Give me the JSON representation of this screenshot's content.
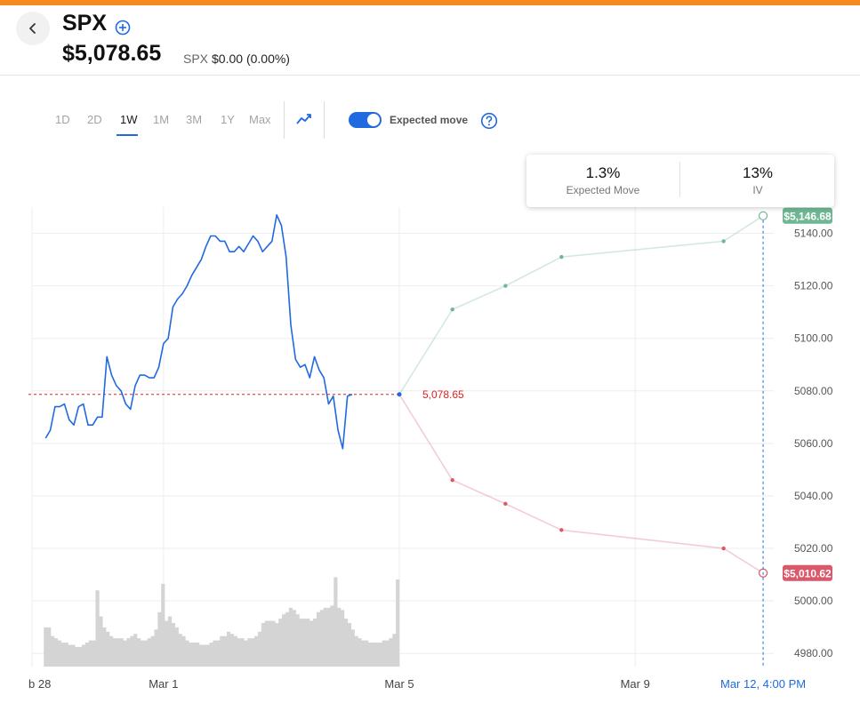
{
  "header": {
    "symbol": "SPX",
    "price": "$5,078.65",
    "sub_symbol": "SPX",
    "change": "$0.00 (0.00%)"
  },
  "ranges": [
    "1D",
    "2D",
    "1W",
    "1M",
    "3M",
    "1Y",
    "Max"
  ],
  "active_range": "1W",
  "toggle": {
    "label": "Expected move",
    "on": true
  },
  "icons": {
    "back": "chevron-left-icon",
    "add": "plus-circle-icon",
    "chart_type": "trend-line-icon",
    "help": "question-circle-icon"
  },
  "expected_move_card": {
    "move_value": "1.3%",
    "move_label": "Expected Move",
    "iv_value": "13%",
    "iv_label": "IV"
  },
  "colors": {
    "accent": "#f68a1e",
    "price_line": "#2069e0",
    "upper_band": "#6fb793",
    "lower_band": "#d9596b",
    "current_price": "#e02020",
    "volume": "#d4d4d4"
  },
  "chart_data": {
    "type": "line",
    "ylim": [
      4975,
      5150
    ],
    "yticks": [
      4980,
      5000,
      5020,
      5040,
      5060,
      5080,
      5100,
      5120,
      5140
    ],
    "ytick_labels": [
      "4980.00",
      "5000.00",
      "5020.00",
      "5040.00",
      "5060.00",
      "5080.00",
      "5100.00",
      "5120.00",
      "5140.00"
    ],
    "xlim": [
      -0.23,
      12.35
    ],
    "xticks": [
      {
        "x": 0,
        "label": "b 28",
        "grid": false
      },
      {
        "x": 2,
        "label": "Mar 1",
        "grid": true
      },
      {
        "x": 6,
        "label": "Mar 5",
        "grid": true
      },
      {
        "x": 10,
        "label": "Mar 9",
        "grid": true
      },
      {
        "x": 12.17,
        "label": "Mar 12, 4:00 PM",
        "grid": false,
        "highlight": true
      }
    ],
    "price_series": {
      "name": "SPX",
      "x": [
        0,
        0.08,
        0.16,
        0.24,
        0.32,
        0.4,
        0.48,
        0.56,
        0.64,
        0.72,
        0.8,
        0.88,
        0.96,
        1.04,
        1.12,
        1.2,
        1.28,
        1.36,
        1.44,
        1.52,
        1.6,
        1.68,
        1.76,
        1.84,
        1.92,
        2,
        2.08,
        2.16,
        2.24,
        2.32,
        2.4,
        2.48,
        2.56,
        2.64,
        2.72,
        2.8,
        2.88,
        2.96,
        3.04,
        3.12,
        3.2,
        3.28,
        3.36,
        3.44,
        3.52,
        3.6,
        3.68,
        3.76,
        3.84,
        3.92,
        4,
        4.08,
        4.16,
        4.24,
        4.32,
        4.4,
        4.48,
        4.56,
        4.64,
        4.72,
        4.8,
        4.88,
        4.96,
        5.04,
        5.12,
        5.2,
        5.28,
        5.36,
        5.44,
        5.52,
        5.6,
        5.68,
        5.76,
        5.84,
        5.92,
        6
      ],
      "y": [
        5062,
        5065,
        5074,
        5074,
        5075,
        5069,
        5067,
        5074,
        5075,
        5067,
        5067,
        5070,
        5070,
        5093,
        5086,
        5082,
        5080,
        5075,
        5073,
        5082,
        5086,
        5086,
        5085,
        5085,
        5089,
        5098,
        5100,
        5112,
        5115,
        5117,
        5120,
        5124,
        5127,
        5130,
        5135,
        5139,
        5139,
        5137,
        5137,
        5133,
        5133,
        5135,
        5133,
        5136,
        5139,
        5137,
        5133,
        5135,
        5137,
        5147,
        5143,
        5131,
        5105,
        5092,
        5089,
        5090,
        5085,
        5093,
        5088,
        5085,
        5075,
        5078,
        5065,
        5058,
        5078,
        5078.65
      ]
    },
    "current_price": {
      "value": 5078.65,
      "label": "5,078.65"
    },
    "expected_move_upper": {
      "x": [
        6,
        6.9,
        7.8,
        8.75,
        11.5,
        12.17
      ],
      "y": [
        5078.65,
        5111,
        5120,
        5131,
        5137,
        5146.68
      ],
      "end_label": "$5,146.68"
    },
    "expected_move_lower": {
      "x": [
        6,
        6.9,
        7.8,
        8.75,
        11.5,
        12.17
      ],
      "y": [
        5078.65,
        5046,
        5037,
        5027,
        5020,
        5010.62
      ],
      "end_label": "$5,010.62"
    },
    "volume": [
      18,
      18,
      14,
      13,
      12,
      11,
      11,
      10,
      10,
      9,
      9,
      10,
      11,
      12,
      12,
      35,
      23,
      18,
      16,
      14,
      13,
      13,
      13,
      12,
      13,
      14,
      15,
      13,
      12,
      12,
      13,
      14,
      17,
      25,
      38,
      21,
      23,
      20,
      18,
      15,
      14,
      12,
      11,
      11,
      11,
      10,
      10,
      10,
      11,
      12,
      12,
      14,
      14,
      16,
      15,
      14,
      13,
      13,
      12,
      13,
      13,
      14,
      16,
      20,
      21,
      21,
      21,
      20,
      22,
      24,
      25,
      27,
      26,
      24,
      22,
      22,
      22,
      21,
      22,
      25,
      26,
      27,
      27,
      28,
      41,
      27,
      26,
      22,
      20,
      17,
      14,
      13,
      12,
      12,
      11,
      11,
      11,
      11,
      12,
      12,
      13,
      15,
      40
    ]
  }
}
